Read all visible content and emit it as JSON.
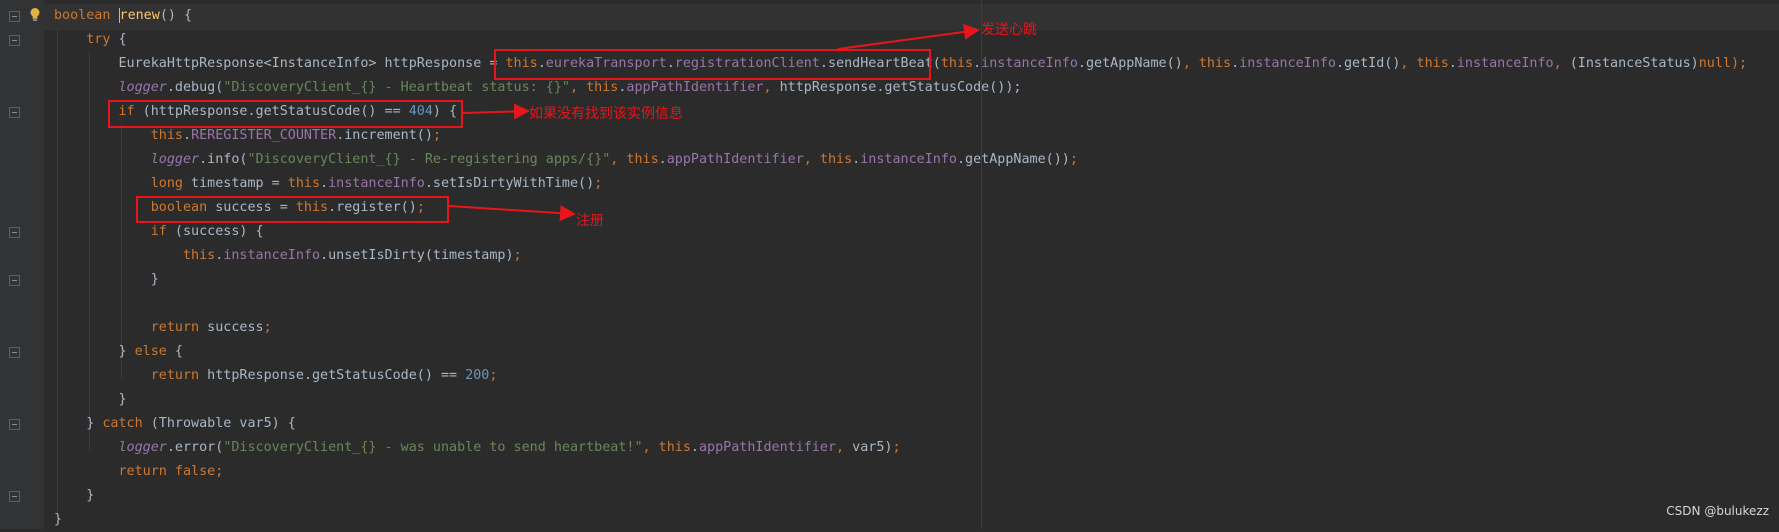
{
  "editor": {
    "lines": [
      [
        {
          "t": "boolean",
          "c": "kw"
        },
        {
          "t": " "
        },
        {
          "t": "r",
          "c": "fn caret"
        },
        {
          "t": "enew",
          "c": "fn"
        },
        {
          "t": "() {"
        }
      ],
      [
        {
          "t": "    "
        },
        {
          "t": "try",
          "c": "kw"
        },
        {
          "t": " {"
        }
      ],
      [
        {
          "t": "        EurekaHttpResponse<InstanceInfo> httpResponse = "
        },
        {
          "t": "this",
          "c": "kw"
        },
        {
          "t": "."
        },
        {
          "t": "eurekaTransport",
          "c": "fld"
        },
        {
          "t": "."
        },
        {
          "t": "registrationClient",
          "c": "fld"
        },
        {
          "t": ".sendHeartBeat("
        },
        {
          "t": "this",
          "c": "kw"
        },
        {
          "t": "."
        },
        {
          "t": "instanceInfo",
          "c": "fld"
        },
        {
          "t": ".getAppName()"
        },
        {
          "t": ", ",
          "c": "kw"
        },
        {
          "t": "this",
          "c": "kw"
        },
        {
          "t": "."
        },
        {
          "t": "instanceInfo",
          "c": "fld"
        },
        {
          "t": ".getId()"
        },
        {
          "t": ", ",
          "c": "kw"
        },
        {
          "t": "this",
          "c": "kw"
        },
        {
          "t": "."
        },
        {
          "t": "instanceInfo",
          "c": "fld"
        },
        {
          "t": ", ",
          "c": "kw"
        },
        {
          "t": "(InstanceStatus)"
        },
        {
          "t": "null",
          "c": "kw"
        },
        {
          "t": ");",
          "c": "kw"
        }
      ],
      [
        {
          "t": "        "
        },
        {
          "t": "logger",
          "c": "log"
        },
        {
          "t": ".debug("
        },
        {
          "t": "\"DiscoveryClient_{} - Heartbeat status: {}\"",
          "c": "str"
        },
        {
          "t": ", ",
          "c": "kw"
        },
        {
          "t": "this",
          "c": "kw"
        },
        {
          "t": "."
        },
        {
          "t": "appPathIdentifier",
          "c": "fld"
        },
        {
          "t": ", ",
          "c": "kw"
        },
        {
          "t": "httpResponse.getStatusCode());"
        }
      ],
      [
        {
          "t": "        "
        },
        {
          "t": "if",
          "c": "kw"
        },
        {
          "t": " (httpResponse.getStatusCode() == "
        },
        {
          "t": "404",
          "c": "num"
        },
        {
          "t": ") {"
        }
      ],
      [
        {
          "t": "            "
        },
        {
          "t": "this",
          "c": "kw"
        },
        {
          "t": "."
        },
        {
          "t": "REREGISTER_COUNTER",
          "c": "fld"
        },
        {
          "t": ".increment()"
        },
        {
          "t": ";",
          "c": "kw"
        }
      ],
      [
        {
          "t": "            "
        },
        {
          "t": "logger",
          "c": "log"
        },
        {
          "t": ".info("
        },
        {
          "t": "\"DiscoveryClient_{} - Re-registering apps/{}\"",
          "c": "str"
        },
        {
          "t": ", ",
          "c": "kw"
        },
        {
          "t": "this",
          "c": "kw"
        },
        {
          "t": "."
        },
        {
          "t": "appPathIdentifier",
          "c": "fld"
        },
        {
          "t": ", ",
          "c": "kw"
        },
        {
          "t": "this",
          "c": "kw"
        },
        {
          "t": "."
        },
        {
          "t": "instanceInfo",
          "c": "fld"
        },
        {
          "t": ".getAppName())"
        },
        {
          "t": ";",
          "c": "kw"
        }
      ],
      [
        {
          "t": "            "
        },
        {
          "t": "long",
          "c": "kw"
        },
        {
          "t": " timestamp = "
        },
        {
          "t": "this",
          "c": "kw"
        },
        {
          "t": "."
        },
        {
          "t": "instanceInfo",
          "c": "fld"
        },
        {
          "t": ".setIsDirtyWithTime()"
        },
        {
          "t": ";",
          "c": "kw"
        }
      ],
      [
        {
          "t": "            "
        },
        {
          "t": "boolean",
          "c": "kw"
        },
        {
          "t": " success = "
        },
        {
          "t": "this",
          "c": "kw"
        },
        {
          "t": ".register()"
        },
        {
          "t": ";",
          "c": "kw"
        }
      ],
      [
        {
          "t": "            "
        },
        {
          "t": "if",
          "c": "kw"
        },
        {
          "t": " (success) {"
        }
      ],
      [
        {
          "t": "                "
        },
        {
          "t": "this",
          "c": "kw"
        },
        {
          "t": "."
        },
        {
          "t": "instanceInfo",
          "c": "fld"
        },
        {
          "t": ".unsetIsDirty(timestamp)"
        },
        {
          "t": ";",
          "c": "kw"
        }
      ],
      [
        {
          "t": "            }"
        }
      ],
      [
        {
          "t": ""
        }
      ],
      [
        {
          "t": "            "
        },
        {
          "t": "return",
          "c": "kw"
        },
        {
          "t": " success"
        },
        {
          "t": ";",
          "c": "kw"
        }
      ],
      [
        {
          "t": "        } "
        },
        {
          "t": "else",
          "c": "kw"
        },
        {
          "t": " {"
        }
      ],
      [
        {
          "t": "            "
        },
        {
          "t": "return",
          "c": "kw"
        },
        {
          "t": " httpResponse.getStatusCode() == "
        },
        {
          "t": "200",
          "c": "num"
        },
        {
          "t": ";",
          "c": "kw"
        }
      ],
      [
        {
          "t": "        }"
        }
      ],
      [
        {
          "t": "    } "
        },
        {
          "t": "catch",
          "c": "kw"
        },
        {
          "t": " (Throwable var5) {"
        }
      ],
      [
        {
          "t": "        "
        },
        {
          "t": "logger",
          "c": "log"
        },
        {
          "t": ".error("
        },
        {
          "t": "\"DiscoveryClient_{} - was unable to send heartbeat!\"",
          "c": "str"
        },
        {
          "t": ", ",
          "c": "kw"
        },
        {
          "t": "this",
          "c": "kw"
        },
        {
          "t": "."
        },
        {
          "t": "appPathIdentifier",
          "c": "fld"
        },
        {
          "t": ", ",
          "c": "kw"
        },
        {
          "t": "var5)"
        },
        {
          "t": ";",
          "c": "kw"
        }
      ],
      [
        {
          "t": "        "
        },
        {
          "t": "return false;",
          "c": "kw"
        }
      ],
      [
        {
          "t": "    }"
        }
      ],
      [
        {
          "t": "}"
        }
      ]
    ]
  },
  "annotations": {
    "heartbeat": "发送心跳",
    "not_found": "如果没有找到该实例信息",
    "register": "注册"
  },
  "watermark": "CSDN @bulukezz",
  "colors": {
    "annotation": "#e8161b",
    "background": "#2b2b2b",
    "keyword": "#cc7832",
    "field": "#9876aa",
    "string": "#6a8759",
    "number": "#6897bb"
  },
  "icons": [
    "lightbulb-icon",
    "fold-marker-icon"
  ]
}
